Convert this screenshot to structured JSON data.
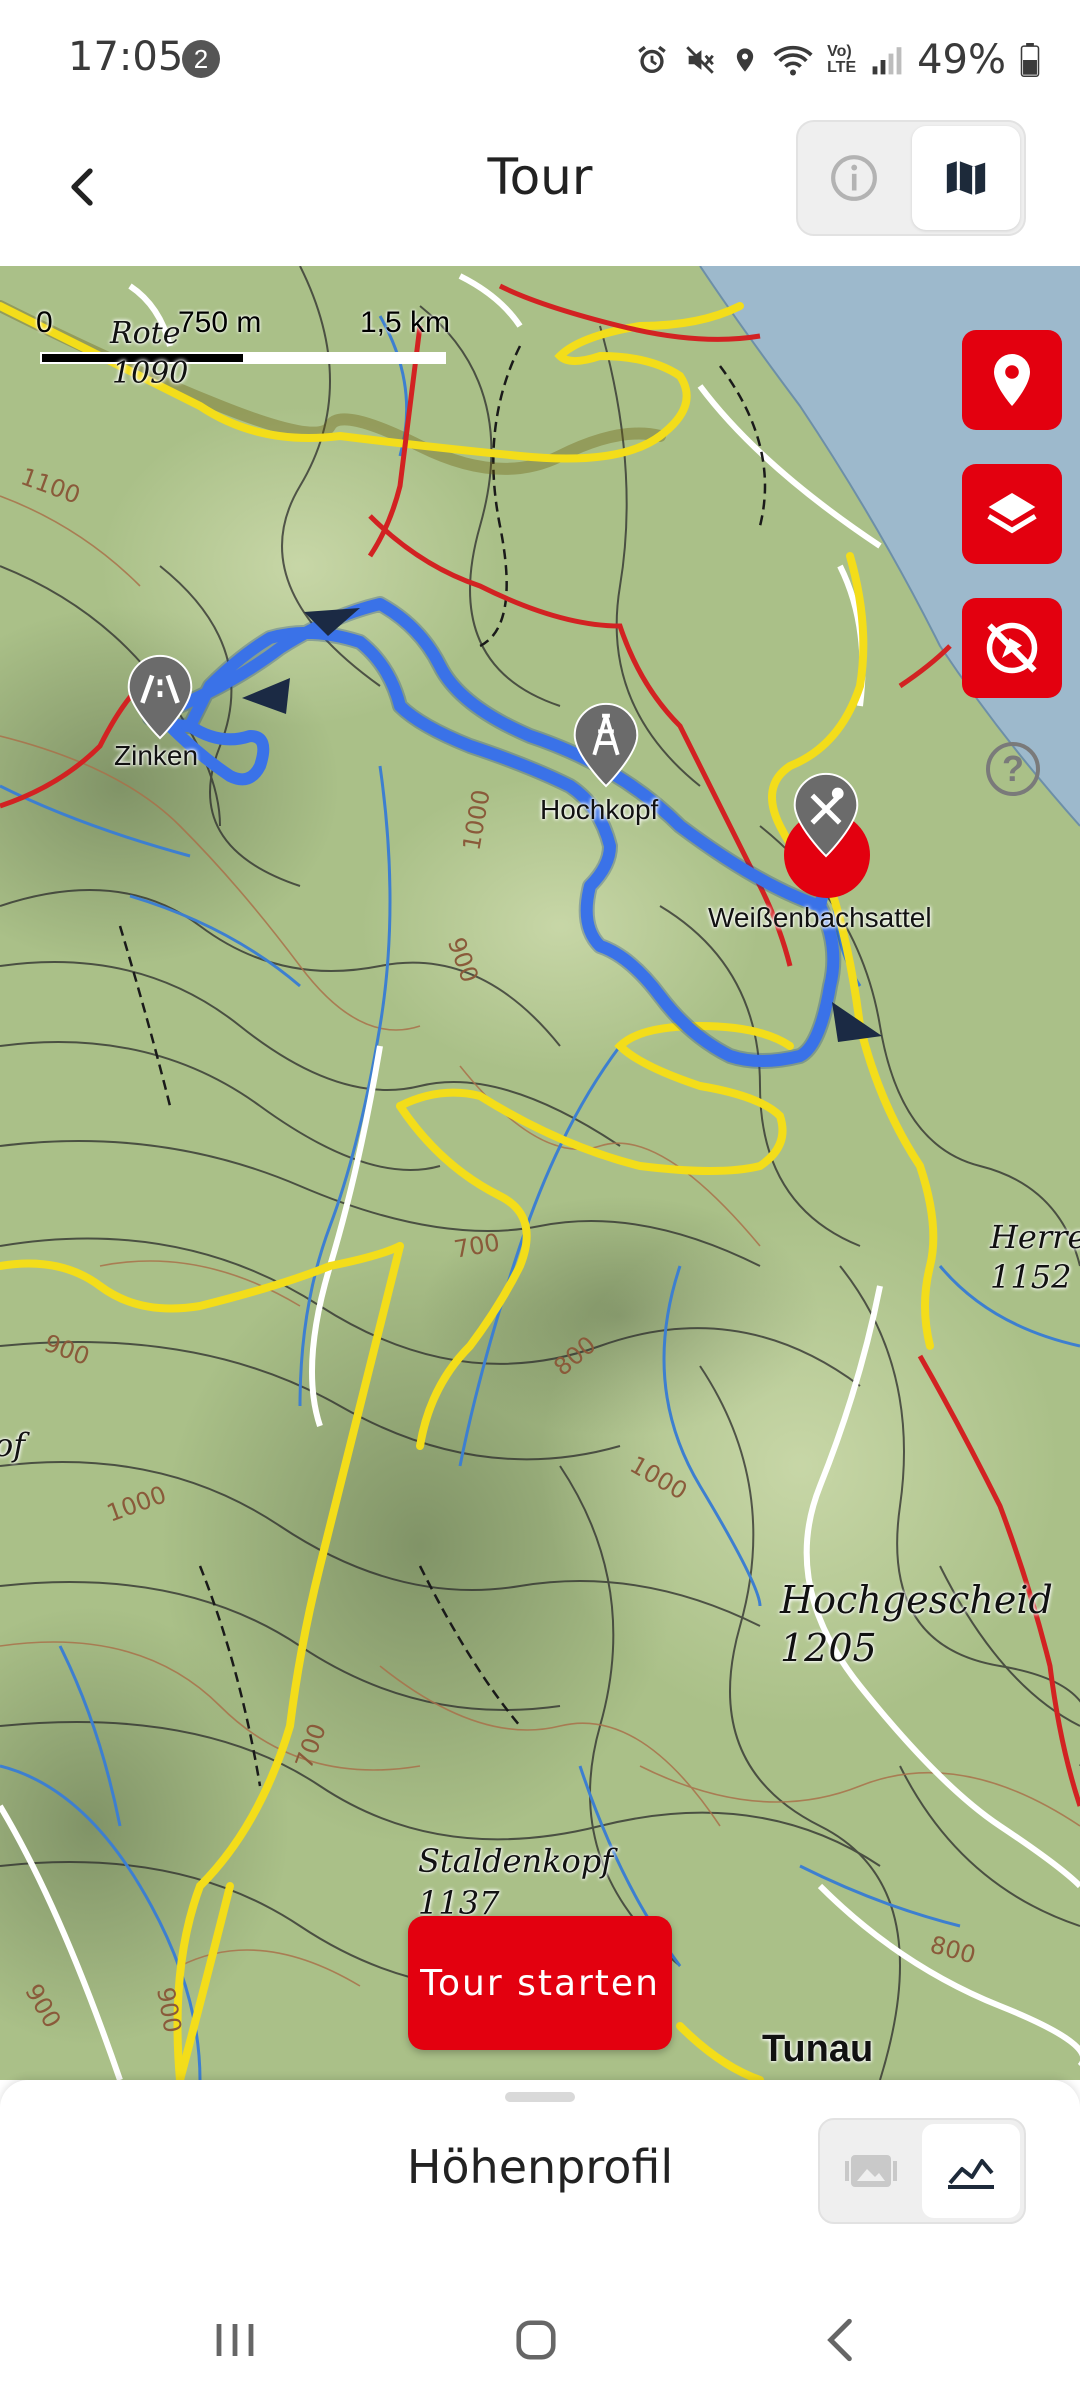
{
  "status": {
    "time": "17:05",
    "notification_count": "2",
    "network": "Vo) LTE",
    "battery": "49%"
  },
  "header": {
    "title": "Tour",
    "info_icon": "info-icon",
    "map_icon": "map-icon"
  },
  "map": {
    "scale": {
      "zero": "0",
      "mid": "750 m",
      "max": "1,5 km"
    },
    "pois": [
      {
        "label": "Zinken",
        "icon": "pass-icon"
      },
      {
        "label": "Hochkopf",
        "icon": "tower-icon"
      },
      {
        "label": "Weißenbachsattel",
        "icon": "restaurant-icon"
      }
    ],
    "places": {
      "rote": "Rote",
      "rote_elev": "1090",
      "herren": "Herren",
      "herren_elev": "1152",
      "hochgescheid": "Hochgescheid",
      "hochgescheid_elev": "1205",
      "staldenkopf": "Staldenkopf",
      "staldenkopf_elev": "1137",
      "tunau": "Tunau",
      "kopf_partial": "of"
    },
    "contour_labels": [
      "1100",
      "1000",
      "900",
      "700",
      "900",
      "800",
      "1000",
      "1000",
      "700",
      "900",
      "800",
      "900"
    ],
    "route_color": "#3a72e8",
    "controls": {
      "location_icon": "location-pin-icon",
      "layers_icon": "layers-icon",
      "no_tracking_icon": "tracking-off-icon",
      "help": "?"
    }
  },
  "start_button": "Tour starten",
  "sheet": {
    "title": "Höhenprofil",
    "image_icon": "gallery-icon",
    "chart_icon": "elevation-chart-icon"
  },
  "accent": "#e3000f"
}
